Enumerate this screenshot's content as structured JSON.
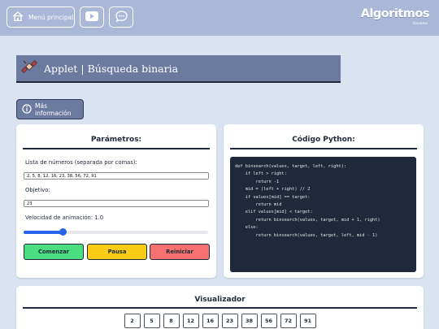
{
  "nav": {
    "menu_label": "Menú principal",
    "brand": "Algoritmos",
    "brand_sub": "Visuales"
  },
  "applet": {
    "title": "Applet | Búsqueda binaria",
    "info_label": "Más información"
  },
  "params": {
    "title": "Parámetros:",
    "list_label": "Lista de números (separada por comas):",
    "list_value": "2, 5, 8, 12, 16, 23, 38, 56, 72, 91",
    "target_label": "Objetivo:",
    "target_value": "23",
    "speed_label": "Velocidad de animación: 1.0",
    "speed_fraction": 0.2,
    "start_label": "Comenzar",
    "pause_label": "Pausa",
    "reset_label": "Reiniciar"
  },
  "code": {
    "title": "Código Python:",
    "lines": [
      "def binsearch(values, target, left, right):",
      "    if left > right:",
      "        return -1",
      "    mid = (left + right) // 2",
      "    if values[mid] == target:",
      "        return mid",
      "    elif values[mid] < target:",
      "        return binsearch(values, target, mid + 1, right)",
      "    else:",
      "        return binsearch(values, target, left, mid - 1)"
    ]
  },
  "viz": {
    "title": "Visualizador",
    "values": [
      "2",
      "5",
      "8",
      "12",
      "16",
      "23",
      "38",
      "56",
      "72",
      "91"
    ]
  },
  "colors": {
    "topbar": "#a9b8d6",
    "header": "#6b7ba0",
    "start": "#4ade80",
    "pause": "#facc15",
    "reset": "#f87171",
    "slider": "#2563eb",
    "code_bg": "#1e293b"
  }
}
